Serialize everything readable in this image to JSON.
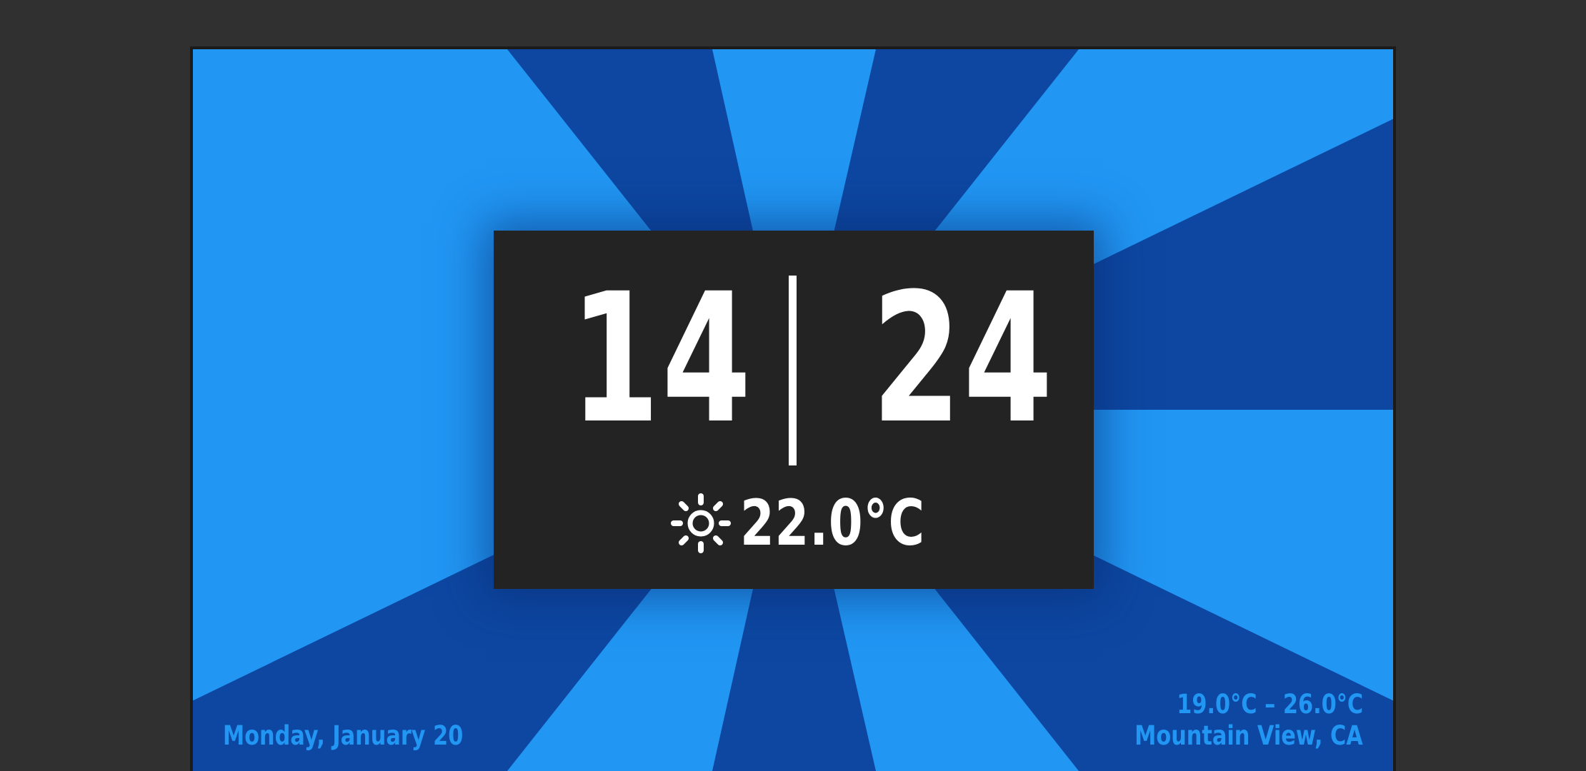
{
  "colors": {
    "background_outer": "#303030",
    "ray_light": "#2196f3",
    "ray_dark": "#0d47a1",
    "card": "#232323",
    "text_primary": "#ffffff",
    "text_accent": "#2196f3"
  },
  "clock": {
    "hours": "14",
    "minutes": "24"
  },
  "weather": {
    "icon": "sun-icon",
    "temperature": "22.0°C",
    "range": "19.0°C – 26.0°C",
    "location": "Mountain View, CA"
  },
  "date": "Monday, January 20"
}
